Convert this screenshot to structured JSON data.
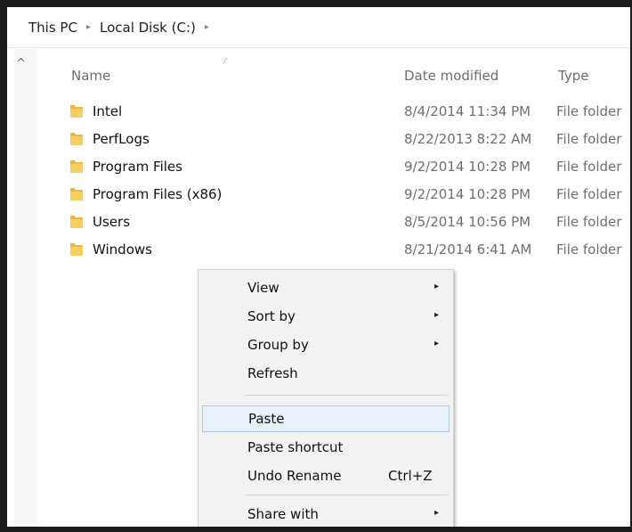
{
  "breadcrumb": {
    "items": [
      "This PC",
      "Local Disk (C:)"
    ],
    "separator": "▸"
  },
  "columns": {
    "name": "Name",
    "date_modified": "Date modified",
    "type": "Type"
  },
  "folders": [
    {
      "name": "Intel",
      "date": "8/4/2014 11:34 PM",
      "type": "File folder"
    },
    {
      "name": "PerfLogs",
      "date": "8/22/2013 8:22 AM",
      "type": "File folder"
    },
    {
      "name": "Program Files",
      "date": "9/2/2014 10:28 PM",
      "type": "File folder"
    },
    {
      "name": "Program Files (x86)",
      "date": "9/2/2014 10:28 PM",
      "type": "File folder"
    },
    {
      "name": "Users",
      "date": "8/5/2014 10:56 PM",
      "type": "File folder"
    },
    {
      "name": "Windows",
      "date": "8/21/2014 6:41 AM",
      "type": "File folder"
    }
  ],
  "context_menu": {
    "view": "View",
    "sort_by": "Sort by",
    "group_by": "Group by",
    "refresh": "Refresh",
    "paste": "Paste",
    "paste_shortcut": "Paste shortcut",
    "undo_rename": "Undo Rename",
    "undo_shortcut": "Ctrl+Z",
    "share_with": "Share with"
  },
  "icons": {
    "folder": "folder-icon",
    "submenu_arrow": "chevron-right-icon",
    "scroll_up": "chevron-up-icon"
  },
  "colors": {
    "folder": "#e8b93a",
    "menu_background": "#f2f2f2",
    "menu_highlight": "#e8f1fb",
    "menu_highlight_border": "#a9c8ea"
  }
}
